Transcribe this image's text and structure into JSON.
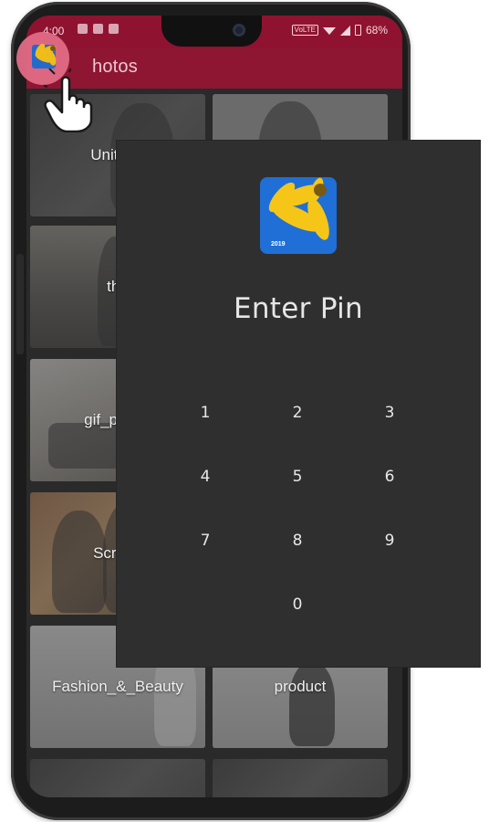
{
  "status_bar": {
    "time": "4:00",
    "volte_badge": "VoLTE",
    "battery": "68%"
  },
  "app_bar": {
    "title": "Photos",
    "title_visible": "hotos"
  },
  "albums": [
    {
      "label": "UnityAd"
    },
    {
      "label": ""
    },
    {
      "label": "thu"
    },
    {
      "label": ""
    },
    {
      "label": "gif_previe"
    },
    {
      "label": ""
    },
    {
      "label": "Screen"
    },
    {
      "label": ""
    },
    {
      "label": "Fashion_&_Beauty"
    },
    {
      "label": "product"
    }
  ],
  "pin_dialog": {
    "logo_year": "2019",
    "title": "Enter Pin",
    "keys": [
      "1",
      "2",
      "3",
      "4",
      "5",
      "6",
      "7",
      "8",
      "9",
      "0"
    ]
  },
  "colors": {
    "status_bar": "#8f1330",
    "app_bar": "#8e1632",
    "pin_panel": "#2f2f2f",
    "logo_blue": "#1f6fd6",
    "logo_yellow": "#f5c518"
  },
  "icons": {
    "pointer": "hand-pointer-icon",
    "logo": "sunflower-app-icon"
  }
}
